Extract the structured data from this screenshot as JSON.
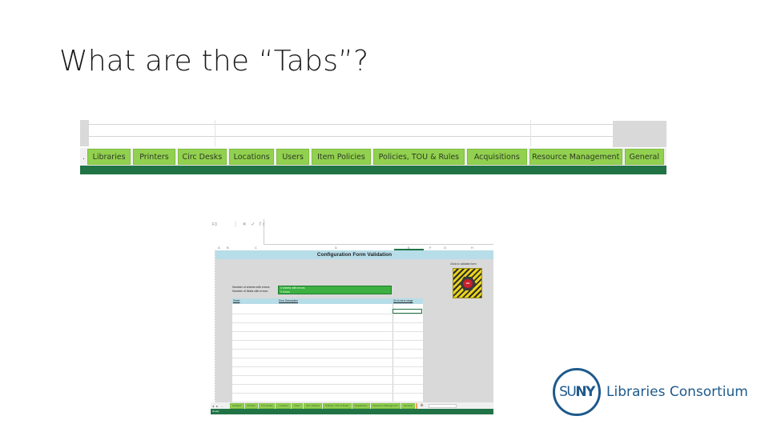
{
  "slide": {
    "title": "What are the “Tabs”?"
  },
  "banner": {
    "scroll_indicator": ".",
    "tabs": [
      {
        "label": "Libraries"
      },
      {
        "label": "Printers"
      },
      {
        "label": "Circ Desks"
      },
      {
        "label": "Locations"
      },
      {
        "label": "Users"
      },
      {
        "label": "Item Policies"
      },
      {
        "label": "Policies, TOU & Rules"
      },
      {
        "label": "Acquisitions"
      },
      {
        "label": "Resource Management"
      },
      {
        "label": "General"
      }
    ],
    "colors": {
      "tab": "#92d050",
      "status_bar": "#217346"
    }
  },
  "spreadsheet": {
    "name_box": "F3",
    "formula_icons": "⋮ ✕ ✓ fx",
    "columns": [
      "A",
      "B",
      "C",
      "D",
      "E",
      "F",
      "G",
      "H"
    ],
    "title": "Configuration Form Validation",
    "click_label": "Click to validate form",
    "validate_button_label": "GO",
    "info_labels": [
      "Number of sheets with errors:",
      "Number of fields with errors:"
    ],
    "info_values": [
      "0 sheets with errors",
      "0 errors"
    ],
    "table_headers": [
      "Sheet",
      "Error Description",
      "Go to error range"
    ],
    "sheet_tabs": [
      "Libraries",
      "Printers",
      "Circ Desks",
      "Locations",
      "Users",
      "Item Policies",
      "Policies, TOU & Rules",
      "Acquisitions",
      "Resource Management",
      "General"
    ],
    "nav_arrows": "◂ ▸ …",
    "add_sheet": "⊕",
    "status": "Ready",
    "colors": {
      "title_bar": "#b7dde8",
      "info_box": "#3cb043",
      "body": "#d9d9d9"
    }
  },
  "logo": {
    "mark_light": "SU",
    "mark_bold": "NY",
    "text": "Libraries Consortium",
    "color": "#1e5a8c"
  }
}
